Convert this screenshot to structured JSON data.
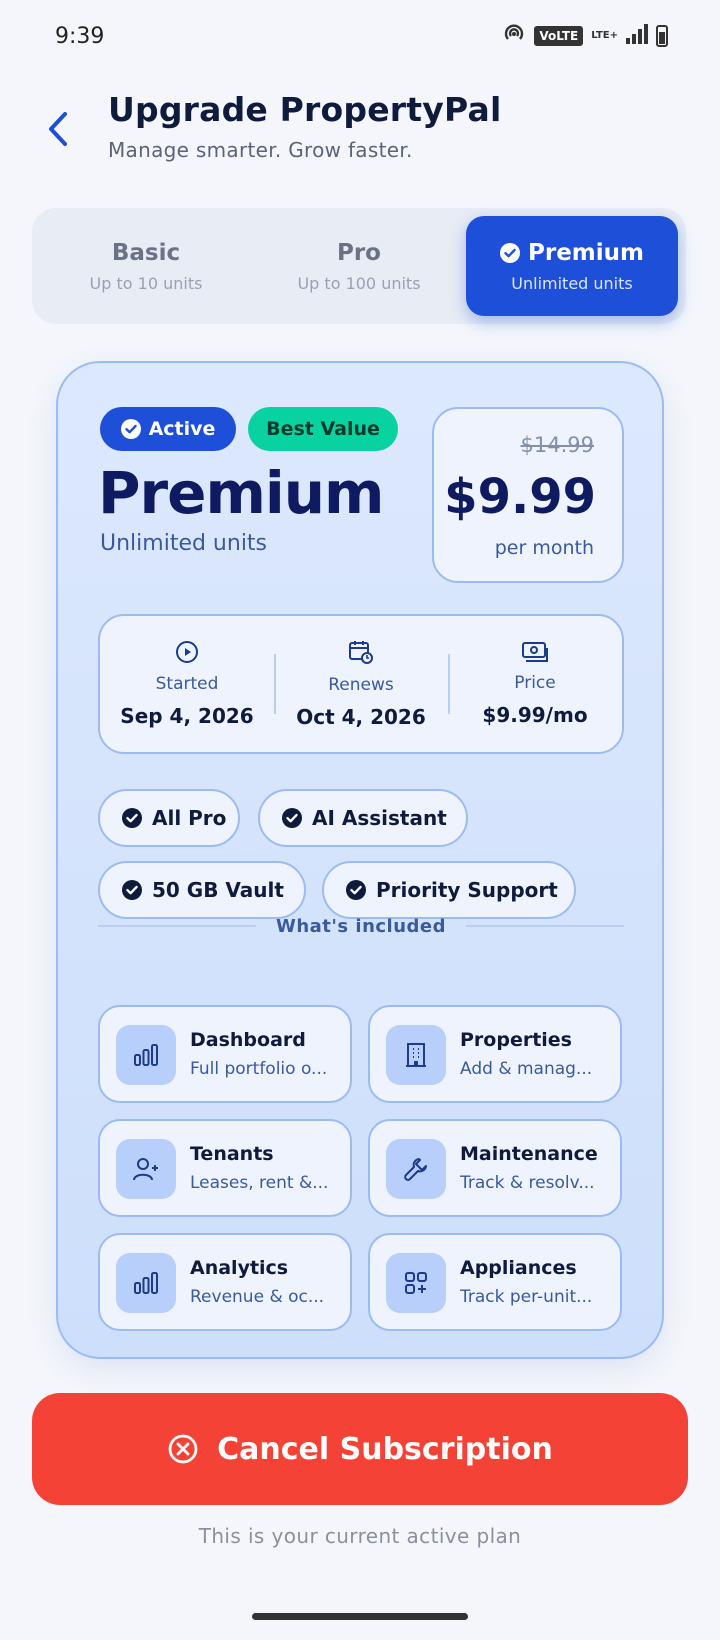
{
  "status_bar": {
    "time": "9:39",
    "volte": "VoLTE",
    "lte": "LTE+"
  },
  "header": {
    "title": "Upgrade PropertyPal",
    "subtitle": "Manage smarter. Grow faster."
  },
  "tabs": [
    {
      "title": "Basic",
      "sub": "Up to 10 units",
      "active": false
    },
    {
      "title": "Pro",
      "sub": "Up to 100 units",
      "active": false
    },
    {
      "title": "Premium",
      "sub": "Unlimited units",
      "active": true
    }
  ],
  "plan": {
    "badge_active": "Active",
    "badge_best": "Best Value",
    "name": "Premium",
    "units": "Unlimited units",
    "price_old": "$14.99",
    "price_new": "$9.99",
    "price_period": "per month",
    "info": [
      {
        "icon": "play-circle-icon",
        "label": "Started",
        "value": "Sep 4, 2026"
      },
      {
        "icon": "calendar-renew-icon",
        "label": "Renews",
        "value": "Oct 4, 2026"
      },
      {
        "icon": "money-icon",
        "label": "Price",
        "value": "$9.99/mo"
      }
    ],
    "chips": [
      "All Pro",
      "AI Assistant",
      "50 GB Vault",
      "Priority Support"
    ],
    "included_label": "What's included",
    "features": [
      {
        "icon": "bar-chart-icon",
        "title": "Dashboard",
        "desc": "Full portfolio o..."
      },
      {
        "icon": "building-icon",
        "title": "Properties",
        "desc": "Add & manag..."
      },
      {
        "icon": "user-add-icon",
        "title": "Tenants",
        "desc": "Leases, rent &..."
      },
      {
        "icon": "wrench-icon",
        "title": "Maintenance",
        "desc": "Track & resolv..."
      },
      {
        "icon": "bar-chart-icon",
        "title": "Analytics",
        "desc": "Revenue & oc..."
      },
      {
        "icon": "apps-add-icon",
        "title": "Appliances",
        "desc": "Track per-unit..."
      }
    ]
  },
  "actions": {
    "cancel_label": "Cancel Subscription",
    "note": "This is your current active plan"
  },
  "colors": {
    "primary": "#1e4fd8",
    "accent_green": "#08d3a0",
    "danger": "#f44336"
  }
}
